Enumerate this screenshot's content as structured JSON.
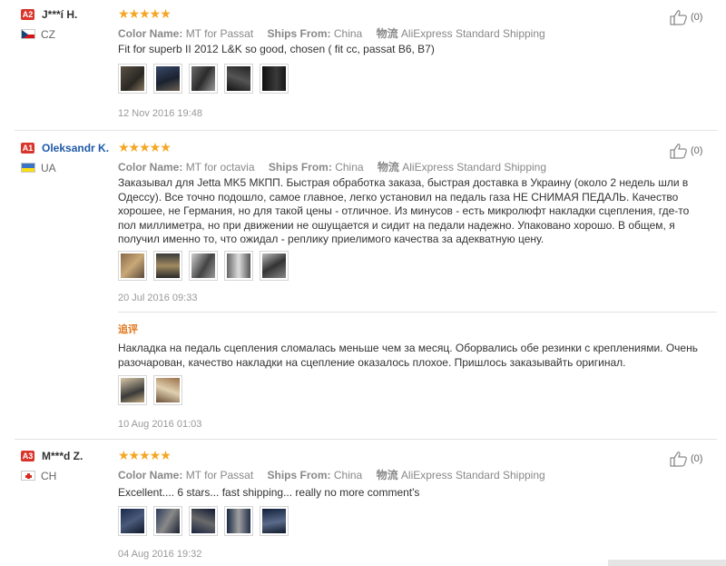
{
  "reviews": [
    {
      "badge": "A2",
      "name": "J***í H.",
      "country": "CZ",
      "stars": "★★★★★",
      "color_label": "Color Name:",
      "color_value": "MT for Passat",
      "ships_label": "Ships From:",
      "ships_value": "China",
      "logistics_label": "物流",
      "logistics_value": "AliExpress Standard Shipping",
      "text": "Fit for superb II 2012 L&K so good, chosen ( fit cc, passat B6, B7)",
      "date": "12 Nov 2016 19:48",
      "likes": "(0)"
    },
    {
      "badge": "A1",
      "name": "Oleksandr K.",
      "country": "UA",
      "stars": "★★★★★",
      "color_label": "Color Name:",
      "color_value": "MT for octavia",
      "ships_label": "Ships From:",
      "ships_value": "China",
      "logistics_label": "物流",
      "logistics_value": "AliExpress Standard Shipping",
      "text": "Заказывал для Jetta MK5 МКПП. Быстрая обработка заказа, быстрая доставка в Украину (около 2 недель шли в Одессу). Все точно подошло, самое главное, легко установил на педаль газа НЕ СНИМАЯ ПЕДАЛЬ. Качество хорошее, не Германия, но для такой цены - отличное. Из минусов - есть микролюфт накладки сцепления, где-то пол миллиметра, но при движении не ошущается и сидит на педали надежно. Упаковано хорошо. В общем, я получил именно то, что ожидал - реплику приелимого качества за адекватную цену.",
      "date": "20 Jul 2016 09:33",
      "likes": "(0)",
      "additional_label": "追评",
      "additional_text": "Накладка на педаль сцепления сломалась меньше чем за месяц. Оборвались обе резинки с креплениями. Очень разочарован, качество накладки на сцепление оказалось плохое. Пришлось заказывайть оригинал.",
      "additional_date": "10 Aug 2016 01:03"
    },
    {
      "badge": "A3",
      "name": "M***d Z.",
      "country": "CH",
      "stars": "★★★★★",
      "color_label": "Color Name:",
      "color_value": "MT for Passat",
      "ships_label": "Ships From:",
      "ships_value": "China",
      "logistics_label": "物流",
      "logistics_value": "AliExpress Standard Shipping",
      "text": "Excellent.... 6 stars... fast shipping... really no more comment's",
      "date": "04 Aug 2016 19:32",
      "likes": "(0)"
    }
  ],
  "colors": {
    "badge": "#d9352b",
    "star": "#f5a623",
    "link": "#1e5aa8",
    "additional": "#e2761c"
  }
}
